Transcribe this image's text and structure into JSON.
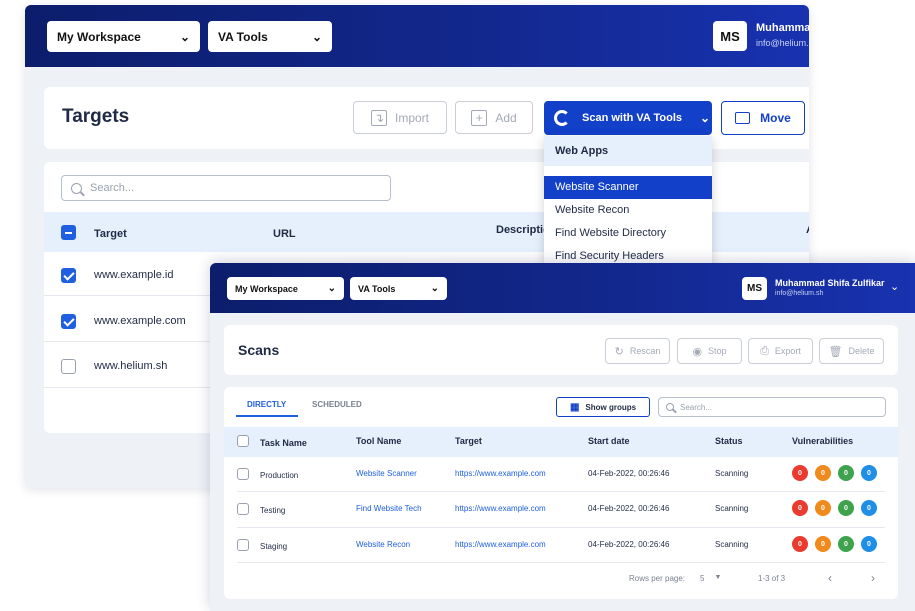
{
  "back": {
    "workspace_select": "My Workspace",
    "tools_select": "VA Tools",
    "user": {
      "initials": "MS",
      "name": "Muhammad Shifa Zulfikar",
      "email": "info@helium.sh"
    },
    "page_title": "Targets",
    "import_label": "Import",
    "add_label": "Add",
    "scan_label": "Scan with VA Tools",
    "move_label": "Move",
    "search_placeholder": "Search...",
    "columns": [
      "Target",
      "URL",
      "Description",
      "A"
    ],
    "rows": [
      {
        "target": "www.example.id",
        "checked": true
      },
      {
        "target": "www.example.com",
        "checked": true
      },
      {
        "target": "www.helium.sh",
        "checked": false
      }
    ],
    "dropdown": {
      "header": "Web Apps",
      "items": [
        "Website Scanner",
        "Website Recon",
        "Find Website Directory",
        "Find Security Headers"
      ],
      "selected": "Website Scanner"
    }
  },
  "front": {
    "workspace_select": "My Workspace",
    "tools_select": "VA Tools",
    "user": {
      "initials": "MS",
      "name": "Muhammad Shifa Zulfikar",
      "email": "info@helium.sh"
    },
    "page_title": "Scans",
    "actions": {
      "rescan": "Rescan",
      "stop": "Stop",
      "export": "Export",
      "delete": "Delete"
    },
    "tabs": [
      "DIRECTLY",
      "SCHEDULED"
    ],
    "active_tab": "DIRECTLY",
    "show_groups": "Show groups",
    "search_placeholder": "Search...",
    "columns": [
      "Task Name",
      "Tool Name",
      "Target",
      "Start date",
      "Status",
      "Vulnerabilities"
    ],
    "rows": [
      {
        "task": "Production",
        "tool": "Website Scanner",
        "target": "https://www.example.com",
        "start": "04-Feb-2022, 00:26:46",
        "status": "Scanning",
        "vulns": [
          "0",
          "0",
          "0",
          "0"
        ]
      },
      {
        "task": "Testing",
        "tool": "Find Website Tech",
        "target": "https://www.example.com",
        "start": "04-Feb-2022, 00:26:46",
        "status": "Scanning",
        "vulns": [
          "0",
          "0",
          "0",
          "0"
        ]
      },
      {
        "task": "Staging",
        "tool": "Website Recon",
        "target": "https://www.example.com",
        "start": "04-Feb-2022, 00:26:46",
        "status": "Scanning",
        "vulns": [
          "0",
          "0",
          "0",
          "0"
        ]
      }
    ],
    "pagination": {
      "rows_per_page_label": "Rows per page:",
      "rows_per_page": "5",
      "range": "1-3 of 3"
    }
  },
  "colors": {
    "navy": "#0b1d6b",
    "primary": "#1240c8",
    "critical": "#ea3b2e",
    "high": "#f08a1c",
    "medium": "#3fa34d",
    "low": "#1e8ee6"
  }
}
